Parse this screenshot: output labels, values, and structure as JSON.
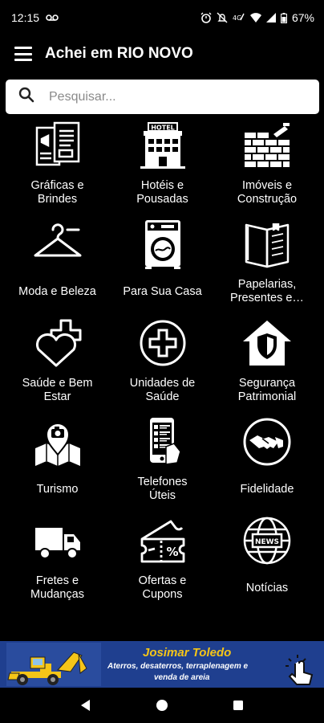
{
  "status": {
    "time": "12:15",
    "battery": "67%"
  },
  "header": {
    "title": "Achei em RIO NOVO"
  },
  "search": {
    "placeholder": "Pesquisar..."
  },
  "categories": [
    {
      "label": "Gráficas e\nBrindes",
      "icon": "printing-brochure-icon"
    },
    {
      "label": "Hotéis e\nPousadas",
      "icon": "hotel-icon"
    },
    {
      "label": "Imóveis e\nConstrução",
      "icon": "brick-wall-icon"
    },
    {
      "label": "Moda e Beleza",
      "icon": "hanger-icon"
    },
    {
      "label": "Para Sua Casa",
      "icon": "washing-machine-icon"
    },
    {
      "label": "Papelarias,\nPresentes e…",
      "icon": "open-book-icon"
    },
    {
      "label": "Saúde e Bem\nEstar",
      "icon": "heart-cross-icon"
    },
    {
      "label": "Unidades de\nSaúde",
      "icon": "medical-cross-icon"
    },
    {
      "label": "Segurança\nPatrimonial",
      "icon": "home-shield-icon"
    },
    {
      "label": "Turismo",
      "icon": "map-camera-icon"
    },
    {
      "label": "Telefones\nÚteis",
      "icon": "phone-directory-icon"
    },
    {
      "label": "Fidelidade",
      "icon": "handshake-icon"
    },
    {
      "label": "Fretes e\nMudanças",
      "icon": "truck-icon"
    },
    {
      "label": "Ofertas e\nCupons",
      "icon": "discount-ticket-icon"
    },
    {
      "label": "Notícias",
      "icon": "news-globe-icon"
    }
  ],
  "banner": {
    "name": "Josimar Toledo",
    "desc_line1": "Aterros, desaterros, terraplenagem e",
    "desc_line2": "venda de areia"
  },
  "colors": {
    "background": "#000000",
    "banner_bg": "#1f3f8f",
    "banner_accent": "#f5c518"
  }
}
